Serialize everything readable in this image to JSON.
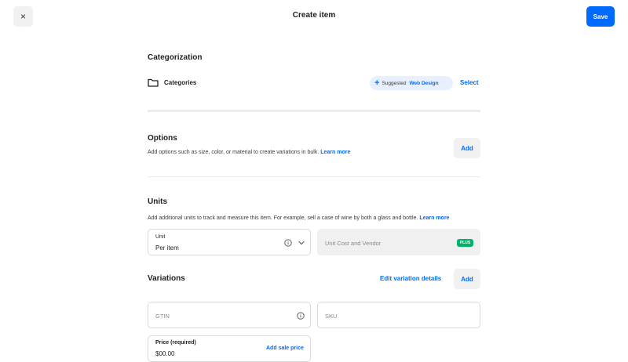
{
  "header": {
    "close_label": "×",
    "title": "Create item",
    "save_label": "Save"
  },
  "categorization": {
    "heading": "Categorization",
    "categories_label": "Categories",
    "suggested_prefix": "Suggested",
    "suggested_value": "Web Design",
    "select_label": "Select"
  },
  "options": {
    "heading": "Options",
    "description": "Add options such as size, color, or material to create variations in bulk.",
    "learn_more": "Learn more",
    "add_label": "Add"
  },
  "units": {
    "heading": "Units",
    "description": "Add additional units to track and measure this item. For example, sell a case of wine by both a glass and bottle.",
    "learn_more": "Learn more",
    "unit_field_label": "Unit",
    "unit_field_value": "Per item",
    "cost_vendor_placeholder": "Unit Cost and Vendor",
    "plus_badge": "PLUS"
  },
  "variations": {
    "heading": "Variations",
    "edit_details_label": "Edit variation details",
    "add_label": "Add",
    "gtin_placeholder": "GTIN",
    "sku_placeholder": "SKU",
    "price_label": "Price (required)",
    "add_sale_price_label": "Add sale price",
    "price_value": "$00.00"
  },
  "colors": {
    "accent": "#006aff",
    "plus_badge": "#00b26a",
    "chip_bg": "#e8f0fe"
  }
}
